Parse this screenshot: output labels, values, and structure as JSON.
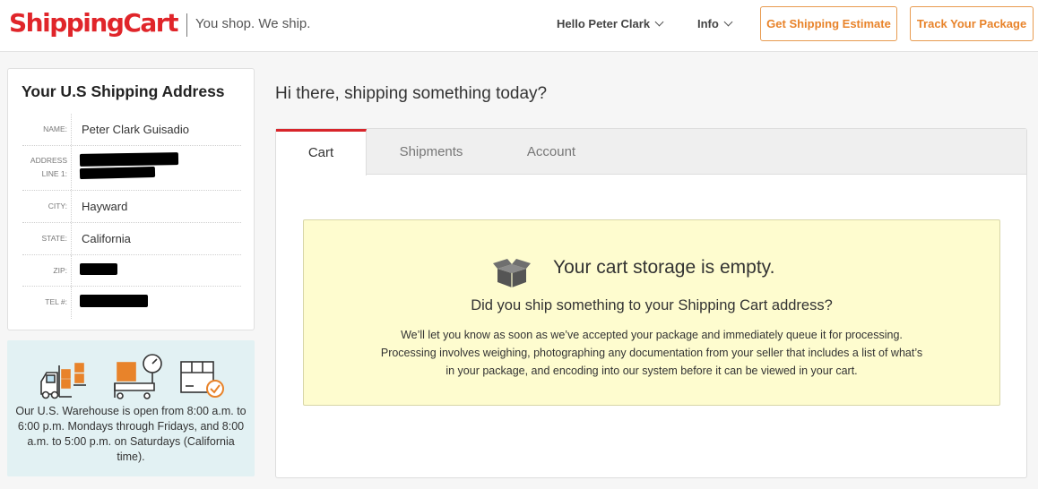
{
  "header": {
    "logo_text": "ShippingCart",
    "tagline": "You shop. We ship.",
    "user_menu_label": "Hello Peter Clark",
    "info_menu_label": "Info",
    "estimate_button": "Get Shipping Estimate",
    "track_button": "Track Your Package",
    "brand_color": "#e0252a",
    "accent_color": "#e8832a"
  },
  "address": {
    "title": "Your U.S Shipping Address",
    "name_label": "NAME:",
    "name_value": "Peter Clark Guisadio",
    "line1_label_a": "ADDRESS",
    "line1_label_b": "LINE 1:",
    "city_label": "CITY:",
    "city_value": "Hayward",
    "state_label": "STATE:",
    "state_value": "California",
    "zip_label": "ZIP:",
    "tel_label": "TEL #:"
  },
  "warehouse": {
    "icons": [
      "forklift-icon",
      "package-scale-icon",
      "box-check-icon"
    ],
    "text": "Our U.S. Warehouse is open from 8:00 a.m. to 6:00 p.m. Mondays through Fridays, and 8:00 a.m. to 5:00 p.m. on Saturdays (California time)."
  },
  "main": {
    "greeting": "Hi there, shipping something today?",
    "tabs": [
      {
        "label": "Cart",
        "active": true
      },
      {
        "label": "Shipments",
        "active": false
      },
      {
        "label": "Account",
        "active": false
      }
    ],
    "empty_title": "Your cart storage is empty.",
    "empty_subtitle": "Did you ship something to your Shipping Cart address?",
    "empty_desc_1": "We’ll let you know as soon as we’ve accepted your package and immediately queue it for processing.",
    "empty_desc_2": "Processing involves weighing, photographing any documentation from your seller that includes a list of what’s",
    "empty_desc_3": "in your package, and encoding into our system before it can be viewed in your cart.",
    "empty_icon": "open-box-icon"
  }
}
